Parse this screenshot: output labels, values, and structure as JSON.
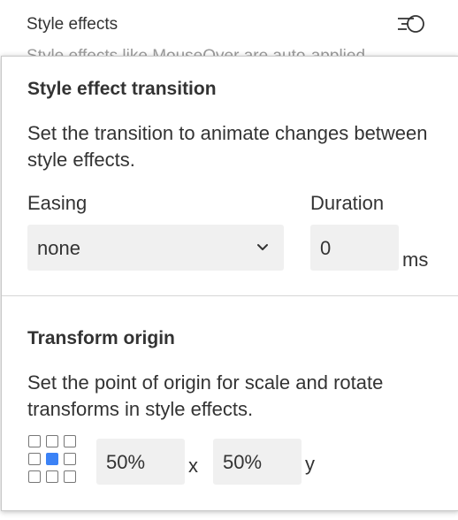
{
  "background": {
    "title": "Style effects",
    "cut_text": "Style effects like MouseOver are auto-applied",
    "icon": "style-effects-list-icon"
  },
  "transition": {
    "title": "Style effect transition",
    "description": "Set the transition to animate changes between style effects.",
    "easing_label": "Easing",
    "easing_value": "none",
    "duration_label": "Duration",
    "duration_value": "0",
    "duration_unit": "ms"
  },
  "origin": {
    "title": "Transform origin",
    "description": "Set the point of origin for scale and rotate transforms in style effects.",
    "x_value": "50%",
    "x_label": "x",
    "y_value": "50%",
    "y_label": "y",
    "selected_point": "center"
  },
  "colors": {
    "accent": "#3b82f6",
    "input_bg": "#f0f0f0",
    "text": "#333333"
  }
}
